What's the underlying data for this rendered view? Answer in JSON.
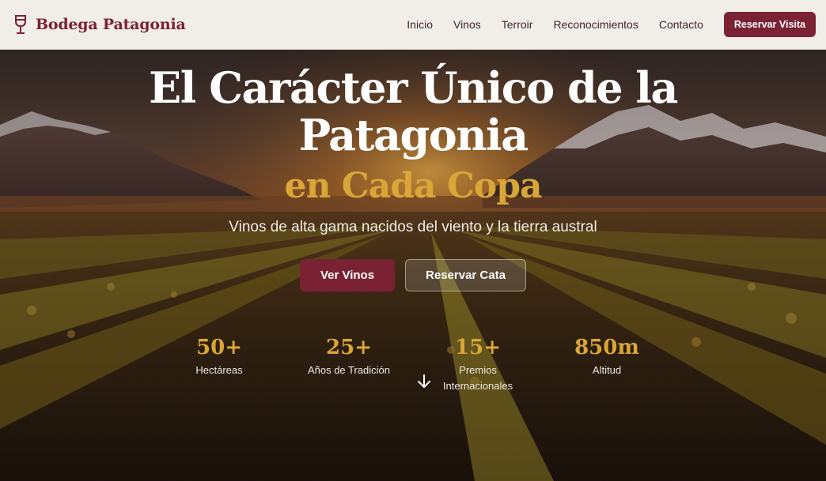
{
  "brand": {
    "name": "Bodega Patagonia",
    "icon": "wine-glass-icon"
  },
  "nav": {
    "links": [
      "Inicio",
      "Vinos",
      "Terroir",
      "Reconocimientos",
      "Contacto"
    ],
    "cta": "Reservar Visita"
  },
  "hero": {
    "title_line1": "El Carácter Único de la",
    "title_line2": "Patagonia",
    "title_accent": "en Cada Copa",
    "subtitle": "Vinos de alta gama nacidos del viento y la tierra austral",
    "primary_button": "Ver Vinos",
    "secondary_button": "Reservar Cata",
    "stats": [
      {
        "value": "50+",
        "label": "Hectáreas"
      },
      {
        "value": "25+",
        "label": "Años de Tradición"
      },
      {
        "value": "15+",
        "label": "Premios Internacionales"
      },
      {
        "value": "850m",
        "label": "Altitud"
      }
    ],
    "scroll_icon": "arrow-down-icon"
  },
  "colors": {
    "brand": "#7a2233",
    "accent_gold": "#d9a637",
    "nav_bg": "#f1ede8"
  }
}
